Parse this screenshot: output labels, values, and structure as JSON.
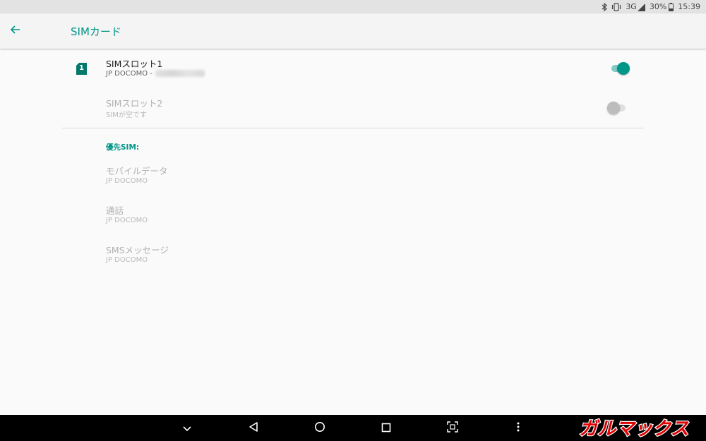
{
  "status_bar": {
    "network": "3G",
    "battery": "30%",
    "time": "15:39",
    "icons": [
      "bluetooth-icon",
      "vibrate-icon",
      "signal-icon",
      "battery-icon"
    ]
  },
  "app_bar": {
    "back_icon": "arrow-left-icon",
    "title": "SIMカード"
  },
  "sim_slots": [
    {
      "title": "SIMスロット1",
      "subtitle": "JP DOCOMO -",
      "badge": "1",
      "enabled": true,
      "switch_on": true
    },
    {
      "title": "SIMスロット2",
      "subtitle": "SIMが空です",
      "enabled": false,
      "switch_on": false
    }
  ],
  "preferred": {
    "header": "優先SIM:",
    "items": [
      {
        "title": "モバイルデータ",
        "subtitle": "JP DOCOMO"
      },
      {
        "title": "通話",
        "subtitle": "JP DOCOMO"
      },
      {
        "title": "SMSメッセージ",
        "subtitle": "JP DOCOMO"
      }
    ]
  },
  "nav_bar": {
    "buttons": [
      "chevron-down-icon",
      "back-triangle-icon",
      "home-circle-icon",
      "recents-square-icon",
      "screenshot-icon",
      "more-vert-icon"
    ]
  },
  "watermark": "ガルマックス",
  "colors": {
    "accent": "#009688",
    "switch_on_track": "#80cbc4",
    "switch_off_thumb": "#bdbdbd",
    "switch_off_track": "#e0e0e0"
  }
}
